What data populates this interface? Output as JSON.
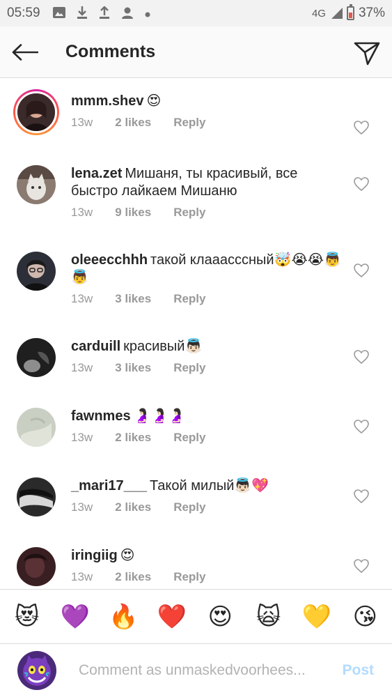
{
  "status_bar": {
    "time": "05:59",
    "network": "4G",
    "battery": "37%",
    "icons": [
      "image-icon",
      "download-icon",
      "upload-icon",
      "person-icon",
      "dot-icon"
    ]
  },
  "header": {
    "title": "Comments"
  },
  "comments": [
    {
      "user": "mmm.shev",
      "text": "😍",
      "time": "13w",
      "likes": "2 likes",
      "reply": "Reply",
      "story": true,
      "avatar_color": "#3b2a2a"
    },
    {
      "user": "lena.zet",
      "text": "Мишаня, ты красивый, все быстро лайкаем Мишаню",
      "time": "13w",
      "likes": "9 likes",
      "reply": "Reply",
      "story": false,
      "avatar_color": "#8a7a70"
    },
    {
      "user": "oleeecchhh",
      "text": "такой клааасссный🤯😭😭👼👼",
      "time": "13w",
      "likes": "3 likes",
      "reply": "Reply",
      "story": false,
      "avatar_color": "#2c2f38"
    },
    {
      "user": "carduill",
      "text": "красивый👼🏻",
      "time": "13w",
      "likes": "3 likes",
      "reply": "Reply",
      "story": false,
      "avatar_color": "#1f1f1f"
    },
    {
      "user": "fawnmes",
      "text": "🤰🏻🤰🏻🤰🏻",
      "time": "13w",
      "likes": "2 likes",
      "reply": "Reply",
      "story": false,
      "avatar_color": "#c9cfc2"
    },
    {
      "user": "_mari17___",
      "text": "Такой милый👼🏻💖",
      "time": "13w",
      "likes": "2 likes",
      "reply": "Reply",
      "story": false,
      "avatar_color": "#2a2a2a"
    },
    {
      "user": "iringiig",
      "text": "😍",
      "time": "13w",
      "likes": "2 likes",
      "reply": "Reply",
      "story": false,
      "avatar_color": "#3a1f22"
    }
  ],
  "emoji_bar": [
    "😻",
    "💜",
    "🔥",
    "❤️",
    "😍",
    "🙀",
    "💛",
    "😘"
  ],
  "comment_input": {
    "placeholder": "Comment as unmaskedvoorhees...",
    "post_label": "Post"
  },
  "colors": {
    "accent_disabled": "#b3dbff",
    "meta_text": "#999999",
    "story_ring": "#d6249f"
  }
}
